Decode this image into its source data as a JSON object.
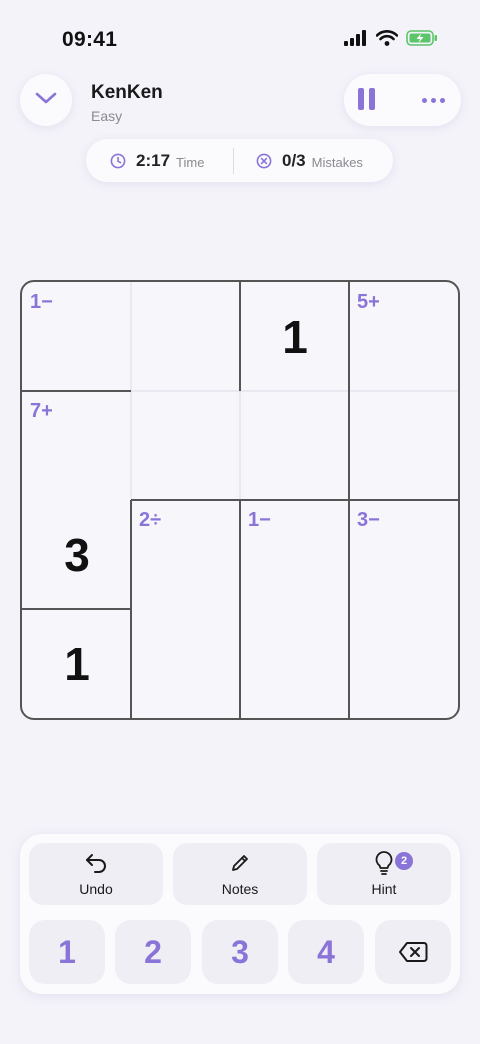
{
  "status_bar": {
    "time": "09:41"
  },
  "header": {
    "title": "KenKen",
    "difficulty": "Easy"
  },
  "stats": {
    "time_value": "2:17",
    "time_label": "Time",
    "mistakes_value": "0/3",
    "mistakes_label": "Mistakes"
  },
  "board": {
    "size": 4,
    "cells": [
      {
        "row": 0,
        "col": 0,
        "cage": "1−",
        "value": ""
      },
      {
        "row": 0,
        "col": 1,
        "cage": "",
        "value": ""
      },
      {
        "row": 0,
        "col": 2,
        "cage": "",
        "value": "1"
      },
      {
        "row": 0,
        "col": 3,
        "cage": "5+",
        "value": ""
      },
      {
        "row": 1,
        "col": 0,
        "cage": "7+",
        "value": ""
      },
      {
        "row": 1,
        "col": 1,
        "cage": "",
        "value": ""
      },
      {
        "row": 1,
        "col": 2,
        "cage": "",
        "value": ""
      },
      {
        "row": 1,
        "col": 3,
        "cage": "",
        "value": ""
      },
      {
        "row": 2,
        "col": 0,
        "cage": "",
        "value": "3"
      },
      {
        "row": 2,
        "col": 1,
        "cage": "2÷",
        "value": ""
      },
      {
        "row": 2,
        "col": 2,
        "cage": "1−",
        "value": ""
      },
      {
        "row": 2,
        "col": 3,
        "cage": "3−",
        "value": ""
      },
      {
        "row": 3,
        "col": 0,
        "cage": "",
        "value": "1"
      },
      {
        "row": 3,
        "col": 1,
        "cage": "",
        "value": ""
      },
      {
        "row": 3,
        "col": 2,
        "cage": "",
        "value": ""
      },
      {
        "row": 3,
        "col": 3,
        "cage": "",
        "value": ""
      }
    ],
    "thick_vertical": [
      [
        0,
        1,
        2
      ],
      [
        0,
        2,
        3
      ],
      [
        1,
        2,
        3
      ],
      [
        2,
        0,
        1
      ],
      [
        2,
        1,
        2
      ],
      [
        2,
        2,
        3
      ],
      [
        3,
        0,
        1
      ],
      [
        3,
        1,
        2
      ],
      [
        3,
        2,
        3
      ]
    ],
    "thick_horizontal": [
      [
        0,
        2,
        0
      ],
      [
        1,
        0,
        1
      ],
      [
        1,
        0,
        2
      ],
      [
        1,
        0,
        3
      ],
      [
        2,
        0,
        0
      ]
    ],
    "thin_vertical": [
      [
        0,
        0,
        1
      ],
      [
        1,
        0,
        1
      ],
      [
        1,
        1,
        2
      ],
      [
        1,
        2,
        3
      ]
    ],
    "thin_horizontal": [
      [
        1,
        2,
        0
      ],
      [
        1,
        2,
        1
      ],
      [
        1,
        2,
        2
      ],
      [
        1,
        2,
        3
      ],
      [
        1,
        0,
        1
      ],
      [
        1,
        0,
        3
      ]
    ]
  },
  "tools": {
    "undo_label": "Undo",
    "notes_label": "Notes",
    "hint_label": "Hint",
    "hint_count": "2"
  },
  "number_pad": [
    "1",
    "2",
    "3",
    "4"
  ],
  "icons": {
    "back": "chevron-down-icon",
    "pause": "pause-icon",
    "more": "more-icon",
    "clock": "clock-icon",
    "mistake": "x-circle-icon",
    "undo": "undo-icon",
    "notes": "pencil-icon",
    "hint": "lightbulb-icon",
    "delete": "backspace-icon"
  },
  "colors": {
    "accent": "#8a74d8",
    "background": "#f4f3fa"
  }
}
